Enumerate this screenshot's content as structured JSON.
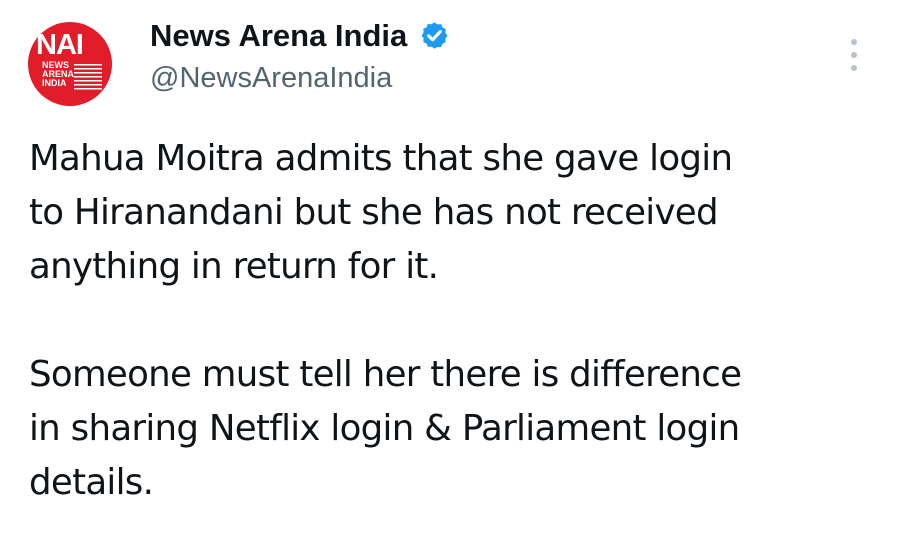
{
  "account": {
    "avatar_main": "NAI",
    "avatar_lines": [
      "NEWS",
      "ARENA",
      "INDIA"
    ],
    "display_name": "News Arena India",
    "handle": "@NewsArenaIndia",
    "verified_icon": "verified-badge-icon",
    "more_icon": "more-options-icon"
  },
  "tweet": {
    "paragraph_1_line_1": "Mahua Moitra admits that she gave login",
    "paragraph_1_line_2": "to Hiranandani but she has not received",
    "paragraph_1_line_3": "anything in return for it.",
    "paragraph_2_line_1": "Someone must tell her there is difference",
    "paragraph_2_line_2": "in sharing Netflix login & Parliament login",
    "paragraph_2_line_3": "details."
  },
  "colors": {
    "avatar_red": "#e11d2a",
    "text_primary": "#0f1419",
    "text_secondary": "#536471",
    "verified_blue": "#1d9bf0",
    "background": "#ffffff"
  }
}
